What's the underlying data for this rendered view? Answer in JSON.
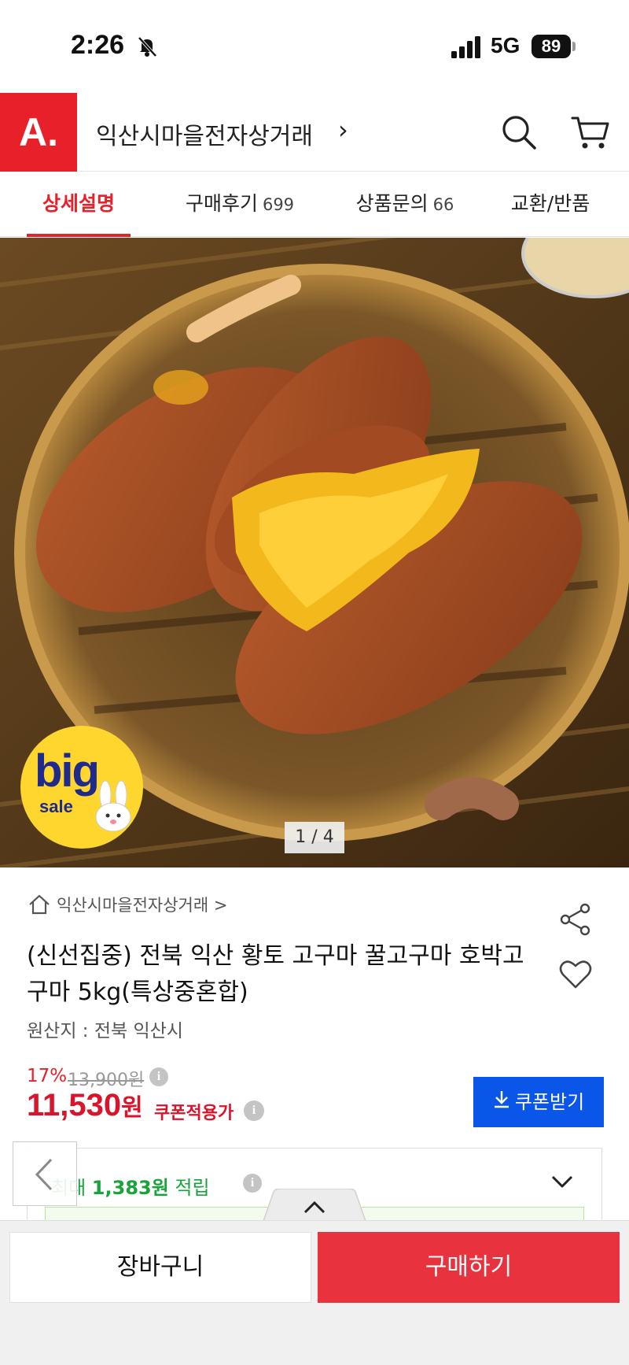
{
  "status_bar": {
    "time": "2:26",
    "network": "5G",
    "battery": "89"
  },
  "header": {
    "logo": "A.",
    "store_name": "익산시마을전자상거래",
    "chevron": "›"
  },
  "tabs": [
    {
      "label": "상세설명",
      "count": ""
    },
    {
      "label": "구매후기",
      "count": "699"
    },
    {
      "label": "상품문의",
      "count": "66"
    },
    {
      "label": "교환/반품",
      "count": ""
    }
  ],
  "hero": {
    "badge_big": "big",
    "badge_sale": "sale",
    "counter": "1 / 4"
  },
  "product": {
    "breadcrumb": "익산시마을전자상거래 >",
    "title": "(신선집중) 전북 익산 황토 고구마 꿀고구마 호박고구마 5kg(특상중혼합)",
    "origin": "원산지 : 전북 익산시",
    "discount": "17%",
    "original_price": "13,900원",
    "sale_price": "11,530",
    "sale_unit": "원",
    "coupon_note": "쿠폰적용가",
    "coupon_button": "쿠폰받기"
  },
  "points": {
    "prefix": "최대 ",
    "amount": "1,383원",
    "suffix": " 적립"
  },
  "bottom_bar": {
    "cart_label": "장바구니",
    "buy_label": "구매하기"
  },
  "colors": {
    "brand_red": "#e8202a",
    "coupon_blue": "#0a56e8",
    "points_green": "#19a33b",
    "buy_red": "#e8323d"
  },
  "icons": [
    "bell-slash-icon",
    "signal-icon",
    "search-icon",
    "cart-icon",
    "home-icon",
    "share-icon",
    "heart-icon",
    "info-icon",
    "download-icon",
    "chevron-down-icon",
    "chevron-left-icon",
    "chevron-up-icon"
  ]
}
